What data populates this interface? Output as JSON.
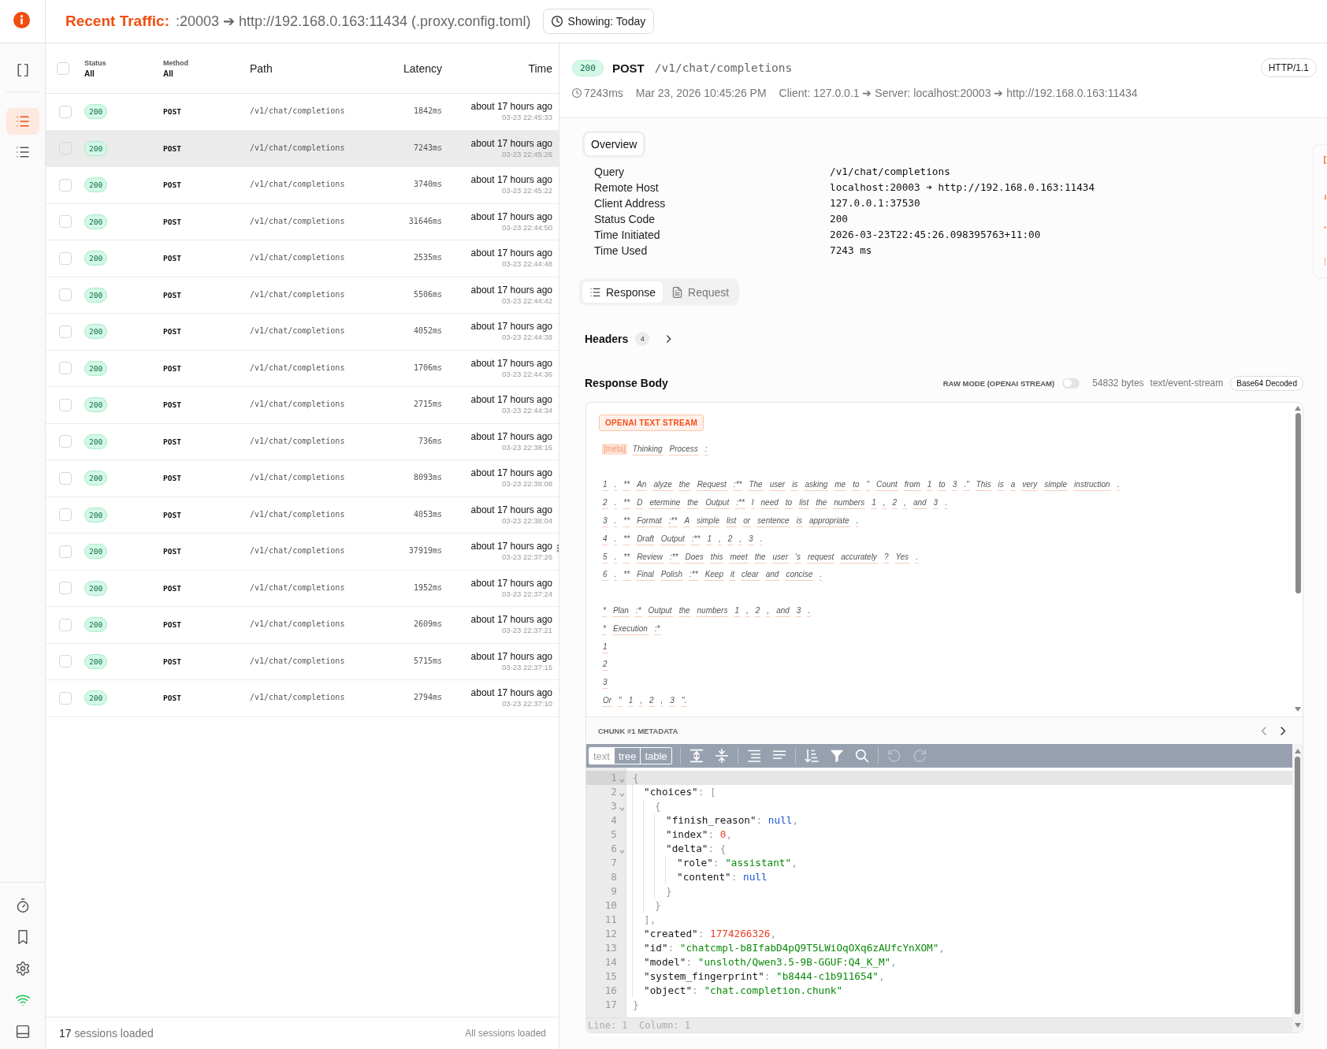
{
  "header": {
    "title": "Recent Traffic:",
    "subtitle": ":20003 ➔ http://192.168.0.163:11434 (.proxy.config.toml)",
    "range_button": "Showing: Today"
  },
  "sidebar": {
    "items": [
      {
        "kind": "panel",
        "selected": false
      },
      {
        "kind": "traffic",
        "selected": true
      },
      {
        "kind": "sessions",
        "selected": false
      }
    ],
    "tools": [
      {
        "kind": "timer"
      },
      {
        "kind": "bookmarks"
      },
      {
        "kind": "settings"
      },
      {
        "kind": "connection"
      },
      {
        "kind": "layout"
      }
    ],
    "online": true
  },
  "table": {
    "select_all": {
      "checked": false
    },
    "columns": [
      {
        "kind": "status",
        "label": "Status",
        "filter": "All"
      },
      {
        "kind": "method",
        "label": "Method",
        "filter": "All"
      },
      {
        "kind": "path",
        "label": "Path"
      },
      {
        "kind": "latency",
        "label": "Latency"
      },
      {
        "kind": "time",
        "label": "Time"
      }
    ],
    "rows": [
      {
        "checked": false,
        "selected": false,
        "status": "200",
        "method": "POST",
        "path": "/v1/chat/completions",
        "latency": "1842ms",
        "time_ago": "about 17 hours ago",
        "timestamp": "03-23 22:45:33"
      },
      {
        "checked": false,
        "selected": true,
        "status": "200",
        "method": "POST",
        "path": "/v1/chat/completions",
        "latency": "7243ms",
        "time_ago": "about 17 hours ago",
        "timestamp": "03-23 22:45:26"
      },
      {
        "checked": false,
        "selected": false,
        "status": "200",
        "method": "POST",
        "path": "/v1/chat/completions",
        "latency": "3740ms",
        "time_ago": "about 17 hours ago",
        "timestamp": "03-23 22:45:22"
      },
      {
        "checked": false,
        "selected": false,
        "status": "200",
        "method": "POST",
        "path": "/v1/chat/completions",
        "latency": "31646ms",
        "time_ago": "about 17 hours ago",
        "timestamp": "03-23 22:44:50"
      },
      {
        "checked": false,
        "selected": false,
        "status": "200",
        "method": "POST",
        "path": "/v1/chat/completions",
        "latency": "2535ms",
        "time_ago": "about 17 hours ago",
        "timestamp": "03-23 22:44:48"
      },
      {
        "checked": false,
        "selected": false,
        "status": "200",
        "method": "POST",
        "path": "/v1/chat/completions",
        "latency": "5506ms",
        "time_ago": "about 17 hours ago",
        "timestamp": "03-23 22:44:42"
      },
      {
        "checked": false,
        "selected": false,
        "status": "200",
        "method": "POST",
        "path": "/v1/chat/completions",
        "latency": "4052ms",
        "time_ago": "about 17 hours ago",
        "timestamp": "03-23 22:44:38"
      },
      {
        "checked": false,
        "selected": false,
        "status": "200",
        "method": "POST",
        "path": "/v1/chat/completions",
        "latency": "1706ms",
        "time_ago": "about 17 hours ago",
        "timestamp": "03-23 22:44:36"
      },
      {
        "checked": false,
        "selected": false,
        "status": "200",
        "method": "POST",
        "path": "/v1/chat/completions",
        "latency": "2715ms",
        "time_ago": "about 17 hours ago",
        "timestamp": "03-23 22:44:34"
      },
      {
        "checked": false,
        "selected": false,
        "status": "200",
        "method": "POST",
        "path": "/v1/chat/completions",
        "latency": "736ms",
        "time_ago": "about 17 hours ago",
        "timestamp": "03-23 22:38:16"
      },
      {
        "checked": false,
        "selected": false,
        "status": "200",
        "method": "POST",
        "path": "/v1/chat/completions",
        "latency": "8093ms",
        "time_ago": "about 17 hours ago",
        "timestamp": "03-23 22:38:08"
      },
      {
        "checked": false,
        "selected": false,
        "status": "200",
        "method": "POST",
        "path": "/v1/chat/completions",
        "latency": "4053ms",
        "time_ago": "about 17 hours ago",
        "timestamp": "03-23 22:38:04"
      },
      {
        "checked": false,
        "selected": false,
        "status": "200",
        "method": "POST",
        "path": "/v1/chat/completions",
        "latency": "37919ms",
        "time_ago": "about 17 hours ago",
        "timestamp": "03-23 22:37:26"
      },
      {
        "checked": false,
        "selected": false,
        "status": "200",
        "method": "POST",
        "path": "/v1/chat/completions",
        "latency": "1952ms",
        "time_ago": "about 17 hours ago",
        "timestamp": "03-23 22:37:24"
      },
      {
        "checked": false,
        "selected": false,
        "status": "200",
        "method": "POST",
        "path": "/v1/chat/completions",
        "latency": "2609ms",
        "time_ago": "about 17 hours ago",
        "timestamp": "03-23 22:37:21"
      },
      {
        "checked": false,
        "selected": false,
        "status": "200",
        "method": "POST",
        "path": "/v1/chat/completions",
        "latency": "5715ms",
        "time_ago": "about 17 hours ago",
        "timestamp": "03-23 22:37:15"
      },
      {
        "checked": false,
        "selected": false,
        "status": "200",
        "method": "POST",
        "path": "/v1/chat/completions",
        "latency": "2794ms",
        "time_ago": "about 17 hours ago",
        "timestamp": "03-23 22:37:10"
      }
    ]
  },
  "footer": {
    "count": "17",
    "count_label": "sessions loaded",
    "status": "All sessions loaded"
  },
  "detail": {
    "status": "200",
    "method": "POST",
    "path": "/v1/chat/completions",
    "protocol": "HTTP/1.1",
    "duration": "7243ms",
    "date": "Mar 23, 2026 10:45:26 PM",
    "route": "Client: 127.0.0.1 ➔ Server: localhost:20003 ➔ http://192.168.0.163:11434",
    "overview": {
      "tab": "Overview",
      "fields": [
        {
          "label": "Query",
          "value": "/v1/chat/completions"
        },
        {
          "label": "Remote Host",
          "value": "localhost:20003 ➔ http://192.168.0.163:11434"
        },
        {
          "label": "Client Address",
          "value": "127.0.0.1:37530"
        },
        {
          "label": "Status Code",
          "value": "200"
        },
        {
          "label": "Time Initiated",
          "value": "2026-03-23T22:45:26.098395763+11:00"
        },
        {
          "label": "Time Used",
          "value": "7243 ms"
        }
      ]
    },
    "tabs": [
      {
        "kind": "response",
        "label": "Response",
        "selected": true
      },
      {
        "kind": "request",
        "label": "Request",
        "selected": false
      }
    ],
    "headers": {
      "label": "Headers",
      "count": "4",
      "expanded": false
    },
    "body": {
      "title": "Response Body",
      "raw_mode": {
        "label": "RAW MODE (OPENAI STREAM)",
        "on": false
      },
      "size": "54832 bytes",
      "content_type": "text/event-stream",
      "encoding": "Base64 Decoded",
      "stream": {
        "badge": "OPENAI TEXT STREAM",
        "lines": [
          {
            "blank_before": false,
            "tag": "[meta]",
            "tokens": [
              "Thinking",
              "Process",
              ":"
            ]
          },
          {
            "blank_before": true,
            "tokens": [
              "1",
              ".",
              "**",
              "An",
              "alyze",
              "the",
              "Request",
              ":**",
              "The",
              "user",
              "is",
              "asking",
              "me",
              "to",
              "\"",
              "Count",
              "from",
              "1",
              "to",
              "3",
              ".\"",
              "This",
              "is",
              "a",
              "very",
              "simple",
              "instruction",
              "."
            ]
          },
          {
            "blank_before": false,
            "tokens": [
              "2",
              ".",
              "**",
              "D",
              "etermine",
              "the",
              "Output",
              ":**",
              "I",
              "need",
              "to",
              "list",
              "the",
              "numbers",
              "1",
              ",",
              "2",
              ",",
              "and",
              "3",
              "."
            ]
          },
          {
            "blank_before": false,
            "tokens": [
              "3",
              ".",
              "**",
              "Format",
              ":**",
              "A",
              "simple",
              "list",
              "or",
              "sentence",
              "is",
              "appropriate",
              "."
            ]
          },
          {
            "blank_before": false,
            "tokens": [
              "4",
              ".",
              "**",
              "Draft",
              "Output",
              ":**",
              "1",
              ",",
              "2",
              ",",
              "3",
              "."
            ]
          },
          {
            "blank_before": false,
            "tokens": [
              "5",
              ".",
              "**",
              "Review",
              ":**",
              "Does",
              "this",
              "meet",
              "the",
              "user",
              "'s",
              "request",
              "accurately",
              "?",
              "Yes",
              "."
            ]
          },
          {
            "blank_before": false,
            "tokens": [
              "6",
              ".",
              "**",
              "Final",
              "Polish",
              ":**",
              "Keep",
              "it",
              "clear",
              "and",
              "concise",
              "."
            ]
          },
          {
            "blank_before": true,
            "tokens": [
              "*",
              "Plan",
              ":*",
              "Output",
              "the",
              "numbers",
              "1",
              ",",
              "2",
              ",",
              "and",
              "3",
              "."
            ]
          },
          {
            "blank_before": false,
            "tokens": [
              "*",
              "Execution",
              ":*"
            ]
          },
          {
            "blank_before": false,
            "tokens": [
              "1"
            ]
          },
          {
            "blank_before": false,
            "tokens": [
              "2"
            ]
          },
          {
            "blank_before": false,
            "tokens": [
              "3"
            ]
          },
          {
            "blank_before": false,
            "tokens": [
              "Or",
              "\"",
              "1",
              ",",
              "2",
              ",",
              "3",
              "\"."
            ]
          }
        ]
      },
      "chunk": {
        "title": "CHUNK #1 METADATA",
        "nav": [
          {
            "kind": "prev",
            "disabled": true
          },
          {
            "kind": "next",
            "disabled": false
          }
        ]
      },
      "editor": {
        "modes": [
          {
            "label": "text",
            "selected": true
          },
          {
            "label": "tree",
            "selected": false
          },
          {
            "label": "table",
            "selected": false
          }
        ],
        "tools": [
          {
            "kind": "expand",
            "disabled": false
          },
          {
            "kind": "collapse",
            "disabled": false
          },
          {
            "kind": "format",
            "disabled": false
          },
          {
            "kind": "compact",
            "disabled": false
          },
          {
            "kind": "sort",
            "disabled": false
          },
          {
            "kind": "filter",
            "disabled": false
          },
          {
            "kind": "search",
            "disabled": false
          },
          {
            "kind": "undo",
            "disabled": true
          },
          {
            "kind": "redo",
            "disabled": true
          }
        ],
        "lines": [
          {
            "no": "1",
            "selected": true,
            "parts": [
              {
                "kind": "punct",
                "text": "{"
              }
            ]
          },
          {
            "no": "2",
            "selected": false,
            "parts": [
              {
                "kind": "key",
                "text": "\"choices\""
              },
              {
                "kind": "punct",
                "text": ": ["
              }
            ]
          },
          {
            "no": "3",
            "selected": false,
            "parts": [
              {
                "kind": "punct",
                "text": "{"
              }
            ]
          },
          {
            "no": "4",
            "selected": false,
            "parts": [
              {
                "kind": "key",
                "text": "\"finish_reason\""
              },
              {
                "kind": "punct",
                "text": ": "
              },
              {
                "kind": "null",
                "text": "null"
              },
              {
                "kind": "punct",
                "text": ","
              }
            ]
          },
          {
            "no": "5",
            "selected": false,
            "parts": [
              {
                "kind": "key",
                "text": "\"index\""
              },
              {
                "kind": "punct",
                "text": ": "
              },
              {
                "kind": "number",
                "text": "0"
              },
              {
                "kind": "punct",
                "text": ","
              }
            ]
          },
          {
            "no": "6",
            "selected": false,
            "parts": [
              {
                "kind": "key",
                "text": "\"delta\""
              },
              {
                "kind": "punct",
                "text": ": {"
              }
            ]
          },
          {
            "no": "7",
            "selected": false,
            "parts": [
              {
                "kind": "key",
                "text": "\"role\""
              },
              {
                "kind": "punct",
                "text": ": "
              },
              {
                "kind": "string",
                "text": "\"assistant\""
              },
              {
                "kind": "punct",
                "text": ","
              }
            ]
          },
          {
            "no": "8",
            "selected": false,
            "parts": [
              {
                "kind": "key",
                "text": "\"content\""
              },
              {
                "kind": "punct",
                "text": ": "
              },
              {
                "kind": "null",
                "text": "null"
              }
            ]
          },
          {
            "no": "9",
            "selected": false,
            "parts": [
              {
                "kind": "punct",
                "text": "}"
              }
            ]
          },
          {
            "no": "10",
            "selected": false,
            "parts": [
              {
                "kind": "punct",
                "text": "}"
              }
            ]
          },
          {
            "no": "11",
            "selected": false,
            "parts": [
              {
                "kind": "punct",
                "text": "],"
              }
            ]
          },
          {
            "no": "12",
            "selected": false,
            "parts": [
              {
                "kind": "key",
                "text": "\"created\""
              },
              {
                "kind": "punct",
                "text": ": "
              },
              {
                "kind": "number",
                "text": "1774266326"
              },
              {
                "kind": "punct",
                "text": ","
              }
            ]
          },
          {
            "no": "13",
            "selected": false,
            "parts": [
              {
                "kind": "key",
                "text": "\"id\""
              },
              {
                "kind": "punct",
                "text": ": "
              },
              {
                "kind": "string",
                "text": "\"chatcmpl-b8IfabD4pQ9T5LWiOqOXq6zAUfcYnXOM\""
              },
              {
                "kind": "punct",
                "text": ","
              }
            ]
          },
          {
            "no": "14",
            "selected": false,
            "parts": [
              {
                "kind": "key",
                "text": "\"model\""
              },
              {
                "kind": "punct",
                "text": ": "
              },
              {
                "kind": "string",
                "text": "\"unsloth/Qwen3.5-9B-GGUF:Q4_K_M\""
              },
              {
                "kind": "punct",
                "text": ","
              }
            ]
          },
          {
            "no": "15",
            "selected": false,
            "parts": [
              {
                "kind": "key",
                "text": "\"system_fingerprint\""
              },
              {
                "kind": "punct",
                "text": ": "
              },
              {
                "kind": "string",
                "text": "\"b8444-c1b911654\""
              },
              {
                "kind": "punct",
                "text": ","
              }
            ]
          },
          {
            "no": "16",
            "selected": false,
            "parts": [
              {
                "kind": "key",
                "text": "\"object\""
              },
              {
                "kind": "punct",
                "text": ": "
              },
              {
                "kind": "string",
                "text": "\"chat.completion.chunk\""
              }
            ]
          },
          {
            "no": "17",
            "selected": false,
            "parts": [
              {
                "kind": "punct",
                "text": "}"
              }
            ]
          }
        ],
        "status": "Line: 1  Column: 1"
      }
    }
  }
}
